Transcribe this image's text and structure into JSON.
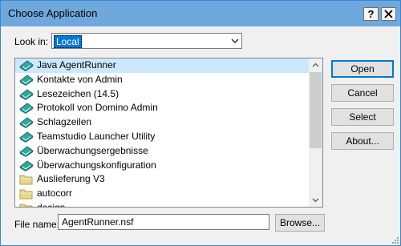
{
  "window": {
    "title": "Choose Application",
    "help_label": "?",
    "close_label": "✕"
  },
  "lookin": {
    "label": "Look in:",
    "value": "Local"
  },
  "list": {
    "items": [
      {
        "label": "Java AgentRunner",
        "icon": "notes-database-icon",
        "selected": true
      },
      {
        "label": "Kontakte von Admin",
        "icon": "notes-database-icon"
      },
      {
        "label": "Lesezeichen (14.5)",
        "icon": "notes-database-icon"
      },
      {
        "label": "Protokoll von Domino Admin",
        "icon": "notes-database-icon"
      },
      {
        "label": "Schlagzeilen",
        "icon": "notes-database-icon"
      },
      {
        "label": "Teamstudio Launcher Utility",
        "icon": "notes-database-icon"
      },
      {
        "label": "Überwachungsergebnisse",
        "icon": "notes-database-icon"
      },
      {
        "label": "Überwachungskonfiguration",
        "icon": "notes-database-icon"
      },
      {
        "label": "Auslieferung V3",
        "icon": "folder-icon"
      },
      {
        "label": "autocorr",
        "icon": "folder-icon"
      },
      {
        "label": "design",
        "icon": "folder-icon"
      }
    ]
  },
  "buttons": {
    "open": "Open",
    "cancel": "Cancel",
    "select": "Select",
    "about": "About..."
  },
  "filename": {
    "label": "File name:",
    "value": "AgentRunner.nsf"
  },
  "browse": "Browse...",
  "colors": {
    "titlebar": "#6fa8dc",
    "selection": "#cce8ff",
    "accent": "#0078d7"
  }
}
